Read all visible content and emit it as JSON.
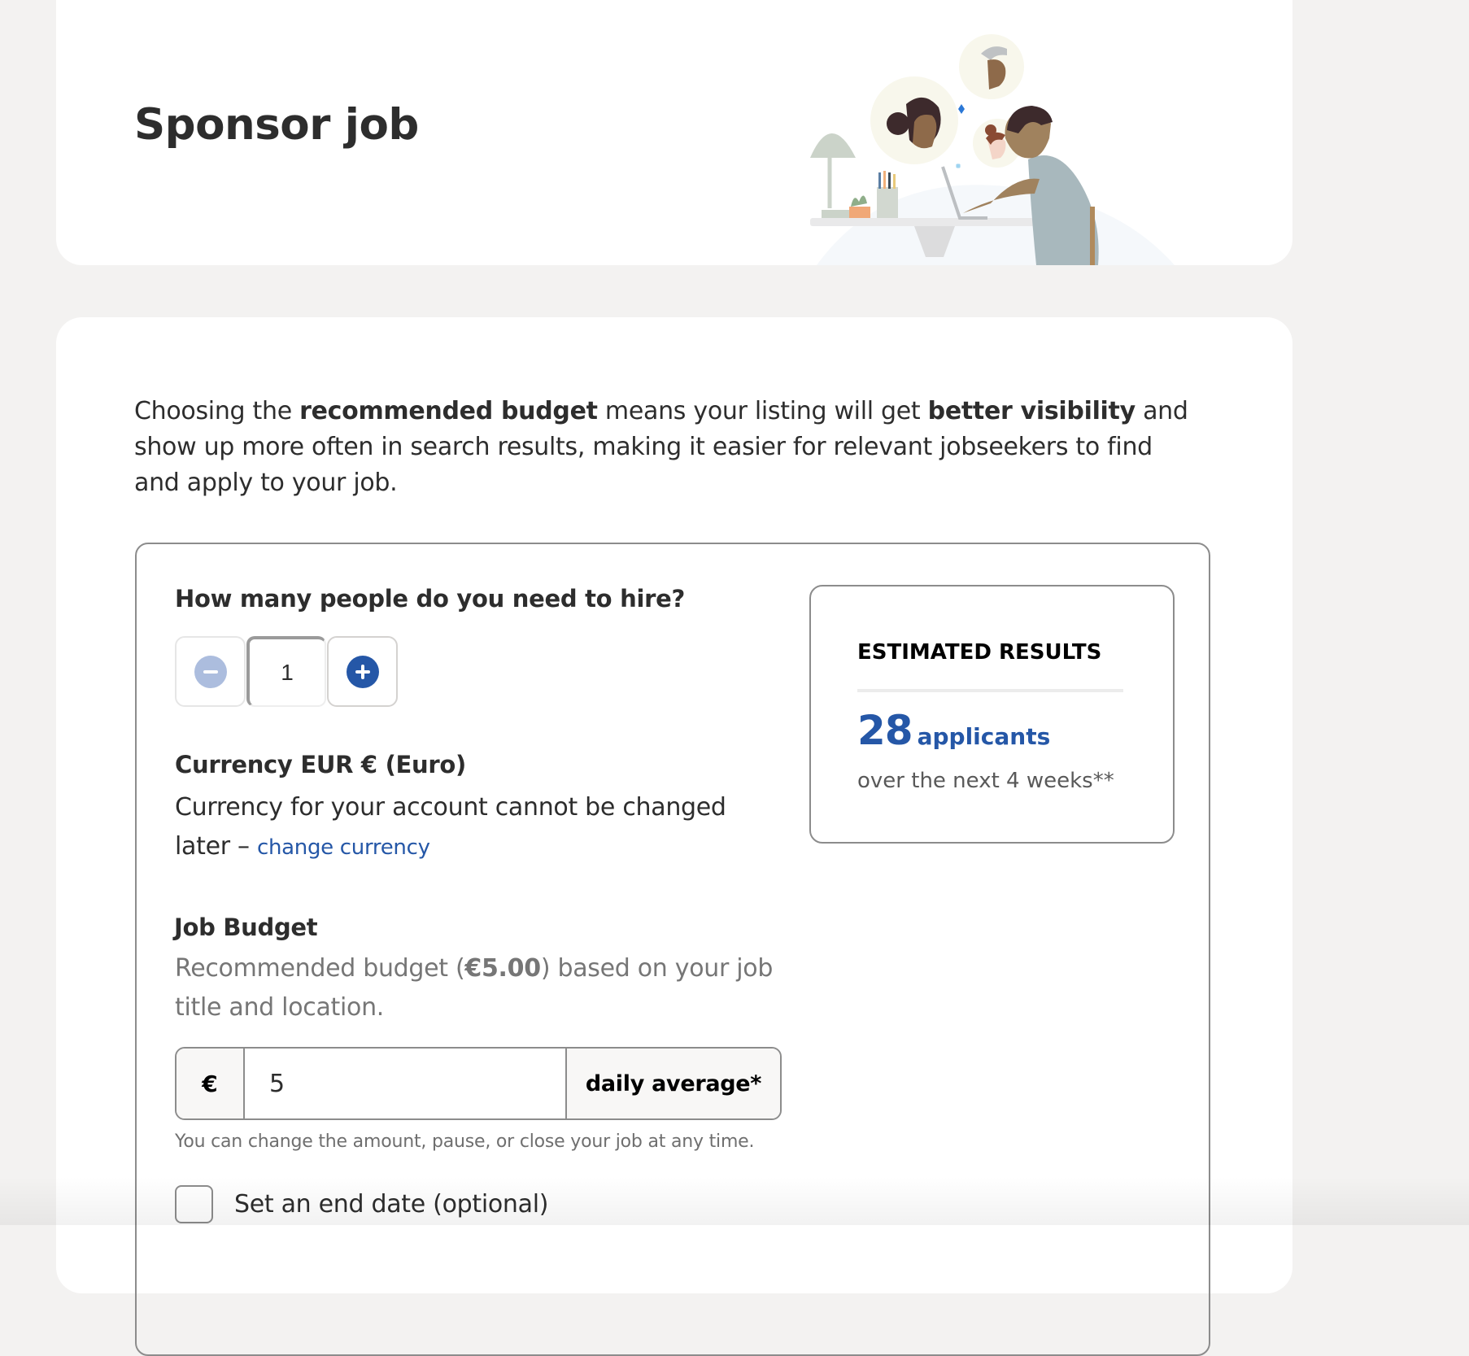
{
  "header": {
    "title": "Sponsor job",
    "illustration": "person-at-desk-with-candidate-avatars-illustration"
  },
  "intro": {
    "part1": "Choosing the ",
    "bold1": "recommended budget",
    "part2": " means your listing will get ",
    "bold2": "better visibility",
    "part3": " and show up more often in search results, making it easier for relevant jobseekers to find and apply to your job."
  },
  "hire": {
    "question": "How many people do you need to hire?",
    "value": "1",
    "decrement_icon": "minus-circle-icon",
    "increment_icon": "plus-circle-icon",
    "decrement_disabled": true
  },
  "currency": {
    "heading": "Currency EUR € (Euro)",
    "text": "Currency for your account cannot be changed later – ",
    "link": "change currency"
  },
  "budget": {
    "heading": "Job Budget",
    "rec_prefix": "Recommended budget (",
    "rec_amount": "€5.00",
    "rec_suffix": ") based on your job title and location.",
    "currency_symbol": "€",
    "value": "5",
    "period": "daily average*",
    "hint": "You can change the amount, pause, or close your job at any time."
  },
  "end_date": {
    "label": "Set an end date (optional)",
    "checked": false
  },
  "results": {
    "heading": "ESTIMATED RESULTS",
    "count": "28",
    "unit": "applicants",
    "subtext": "over the next 4 weeks**"
  },
  "colors": {
    "accent": "#2557a7",
    "accent_disabled": "#acbdde",
    "page_bg": "#f3f2f1",
    "text": "#2d2d2d",
    "muted": "#767676",
    "border": "#8c8c8c"
  }
}
